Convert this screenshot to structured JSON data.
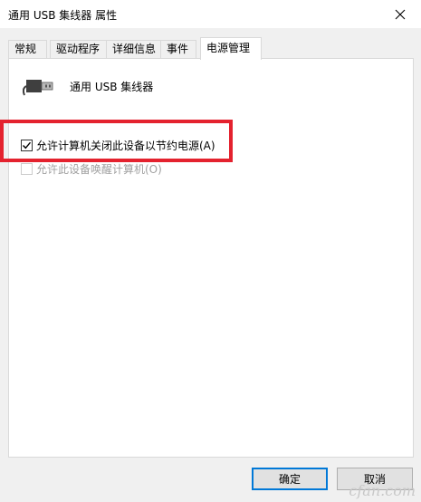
{
  "window": {
    "title": "通用 USB 集线器 属性"
  },
  "tabs": [
    {
      "label": "常规"
    },
    {
      "label": "驱动程序"
    },
    {
      "label": "详细信息"
    },
    {
      "label": "事件"
    },
    {
      "label": "电源管理",
      "active": true
    }
  ],
  "device": {
    "name": "通用 USB 集线器",
    "icon": "usb-plug-icon"
  },
  "options": [
    {
      "label": "允许计算机关闭此设备以节约电源(A)",
      "checked": true,
      "enabled": true
    },
    {
      "label": "允许此设备唤醒计算机(O)",
      "checked": false,
      "enabled": false
    }
  ],
  "buttons": {
    "ok": "确定",
    "cancel": "取消"
  },
  "watermark": "cfan.com",
  "colors": {
    "highlight_border": "#e4222e",
    "default_button_border": "#0078d7",
    "disabled_text": "#a0a0a0"
  }
}
